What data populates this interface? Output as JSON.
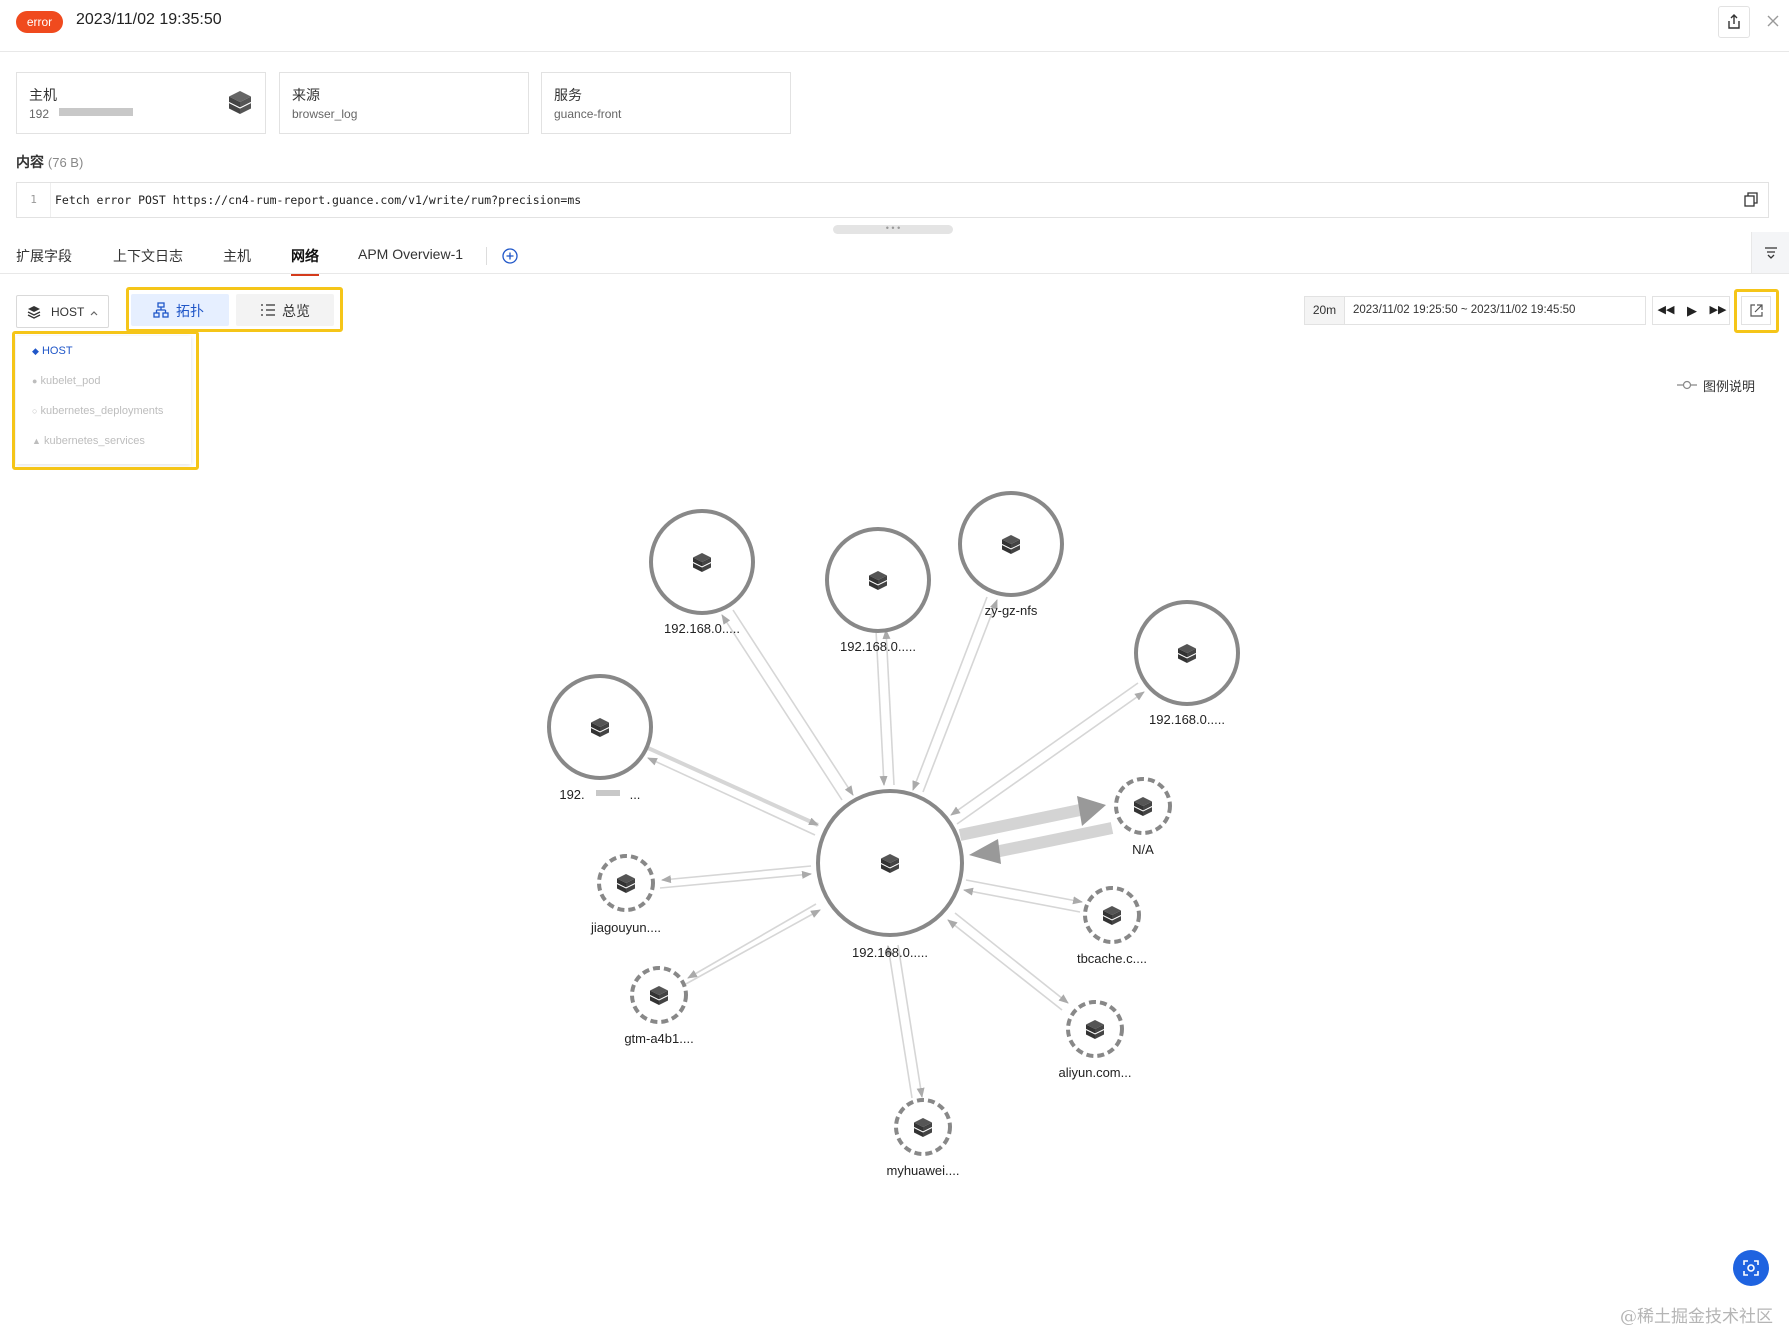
{
  "header": {
    "status": "error",
    "timestamp": "2023/11/02 19:35:50"
  },
  "cards": {
    "host": {
      "label": "主机",
      "value": "192"
    },
    "source": {
      "label": "来源",
      "value": "browser_log"
    },
    "service": {
      "label": "服务",
      "value": "guance-front"
    }
  },
  "content": {
    "label": "内容",
    "size": "(76 B)",
    "line_number": "1",
    "text": "Fetch error POST https://cn4-rum-report.guance.com/v1/write/rum?precision=ms"
  },
  "tabs": [
    "扩展字段",
    "上下文日志",
    "主机",
    "网络",
    "APM Overview-1"
  ],
  "active_tab": "网络",
  "toolbar": {
    "object_type": "HOST",
    "view_topology": "拓扑",
    "view_overview": "总览",
    "time_range": "20m",
    "time_span": "2023/11/02 19:25:50 ~ 2023/11/02 19:45:50"
  },
  "dropdown": {
    "items": [
      "HOST",
      "kubelet_pod",
      "kubernetes_deployments",
      "kubernetes_services"
    ],
    "selected": "HOST"
  },
  "legend_label": "图例说明",
  "graph": {
    "center": "192.168.0.....",
    "nodes": [
      "192.168.0.....",
      "192.168.0.....",
      "zy-gz-nfs",
      "192.168.0.....",
      "192.",
      "N/A",
      "jiagouyun....",
      "tbcache.c....",
      "gtm-a4b1....",
      "aliyun.com...",
      "myhuawei...."
    ],
    "node_5_suffix": "..."
  },
  "watermark": "@稀土掘金技术社区",
  "colors": {
    "error": "#f04a1e",
    "accent": "#1f56c8",
    "highlight": "#f5c518",
    "tab_underline": "#d43b1c"
  }
}
